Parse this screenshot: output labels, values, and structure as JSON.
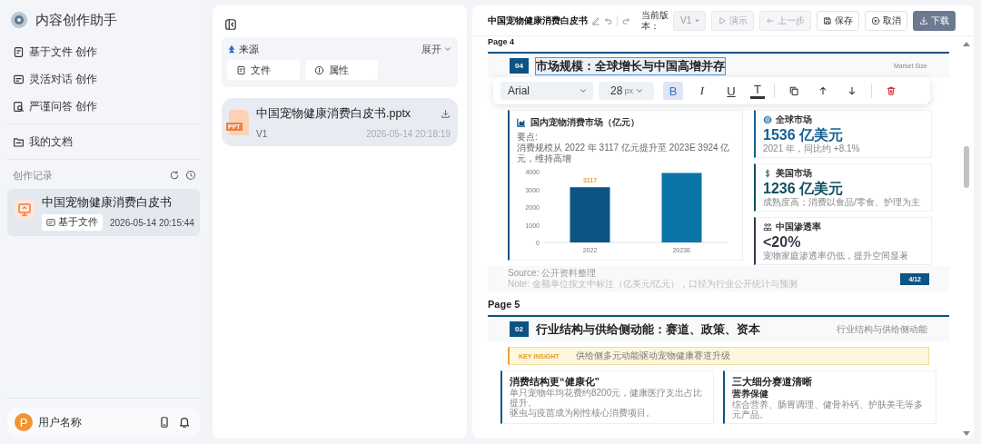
{
  "app": {
    "title": "内容创作助手"
  },
  "sidebar": {
    "menu": [
      {
        "label": "基于文件 创作",
        "kind": "file"
      },
      {
        "label": "灵活对话 创作",
        "kind": "chat"
      },
      {
        "label": "严谨问答 创作",
        "kind": "qa"
      }
    ],
    "documents": {
      "label": "我的文档"
    },
    "history": {
      "title": "创作记录",
      "records": [
        {
          "title": "中国宠物健康消费白皮书",
          "tag": "基于文件",
          "time": "2026-05-14 20:15:44",
          "selected": true
        }
      ]
    },
    "user": {
      "avatar": "P",
      "name": "用户名称"
    }
  },
  "source_panel": {
    "title": "来源",
    "toggle": "展开",
    "chips": [
      {
        "label": "文件",
        "kind": "file"
      },
      {
        "label": "属性",
        "kind": "info"
      }
    ],
    "files": [
      {
        "name": "中国宠物健康消费白皮书.pptx",
        "type": "PPT",
        "version": "V1",
        "time": "2026-05-14 20:18:19"
      }
    ]
  },
  "editor": {
    "title": "中国宠物健康消费白皮书",
    "version_label": "当前版本：",
    "version": "V1",
    "buttons": [
      {
        "label": "演示",
        "kind": "play",
        "disabled": true
      },
      {
        "label": "上一步",
        "kind": "back",
        "disabled": true
      },
      {
        "label": "保存",
        "kind": "save",
        "disabled": false
      },
      {
        "label": "取消",
        "kind": "cancel",
        "disabled": false
      },
      {
        "label": "下载",
        "kind": "download",
        "disabled": false
      }
    ],
    "format_toolbar": {
      "font": "Arial",
      "size": "28",
      "unit": "px",
      "tools": [
        {
          "kind": "bold",
          "glyph": "B",
          "on": true
        },
        {
          "kind": "italic",
          "glyph": "I",
          "on": false
        },
        {
          "kind": "underline",
          "glyph": "U",
          "on": false
        },
        {
          "kind": "color",
          "glyph": "T",
          "on": false
        },
        {
          "kind": "copy"
        },
        {
          "kind": "up"
        },
        {
          "kind": "down"
        },
        {
          "kind": "delete"
        }
      ]
    },
    "pages": [
      {
        "label": "Page 4",
        "kind": "market",
        "number": "04",
        "title": "市场规模：全球增长与中国高增并存",
        "title_selected": true,
        "tag": "Market Size",
        "chart_card": {
          "title": "国内宠物消费市场（亿元）",
          "note_label": "要点:",
          "note": "消费规模从 2022 年 3117 亿元提升至 2023E 3924 亿元，维持高增",
          "chart_data": {
            "type": "bar",
            "categories": [
              "2022",
              "2023E"
            ],
            "series": [
              {
                "color": "#0b5484",
                "values": [
                  3117,
                  null
                ]
              },
              {
                "color": "#0a76a8",
                "values": [
                  null,
                  3924
                ]
              }
            ],
            "stacked": true,
            "ylim": [
              0,
              4000
            ],
            "yticks": [
              0,
              1000,
              2000,
              3000,
              4000
            ],
            "value_labels": [
              "3117",
              null
            ]
          }
        },
        "stats": [
          {
            "kind": "globe",
            "label": "全球市场",
            "value": "1536 亿美元",
            "caption": "2021 年，同比约 +8.1%",
            "color": "#135f92"
          },
          {
            "kind": "dollar",
            "label": "美国市场",
            "value": "1236 亿美元",
            "caption": "成熟度高；消费以食品/零食、护理为主",
            "color": "#0f4f5e"
          },
          {
            "kind": "people",
            "label": "中国渗透率",
            "value": "<20%",
            "caption": "宠物家庭渗透率仍低，提升空间显著",
            "color": "#333a44"
          }
        ],
        "source": "Source: 公开资料整理",
        "note": "Note: 金额单位按文中标注（亿美元/亿元），口径为行业公开统计与预测",
        "page_number": "4/12"
      },
      {
        "label": "Page 5",
        "kind": "structure",
        "number": "02",
        "title": "行业结构与供给侧动能：赛道、政策、资本",
        "title_selected": false,
        "tag": "行业结构与供给侧动能",
        "insight": {
          "label": "KEY INSIGHT",
          "text": "供给侧多元动能驱动宠物健康赛道升级"
        },
        "columns": [
          {
            "title": "消费结构更“健康化”",
            "items": [
              {
                "kind": "text",
                "text": "单只宠物年均花费约8200元，健康医疗支出占比提升。"
              },
              {
                "kind": "text",
                "text": "驱虫与疫苗成为刚性核心消费项目。"
              }
            ]
          },
          {
            "title": "三大细分赛道清晰",
            "items": [
              {
                "kind": "heading",
                "text": "营养保健"
              },
              {
                "kind": "text",
                "text": "综合营养、肠胃调理、健骨补钙、护肤美毛等多元产品。"
              }
            ]
          }
        ]
      }
    ]
  }
}
